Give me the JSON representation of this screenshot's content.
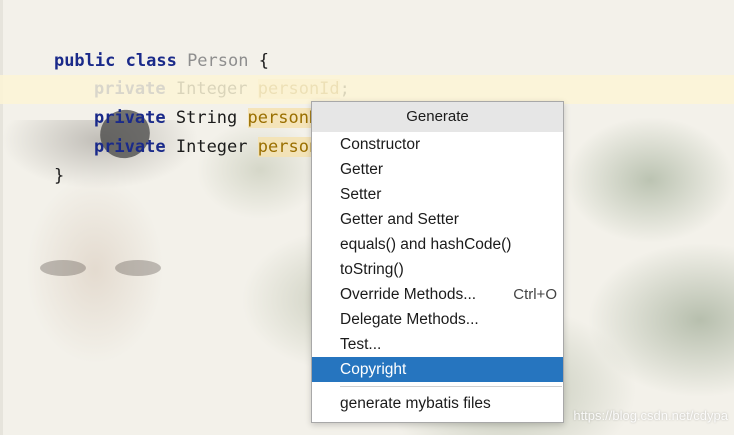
{
  "editor": {
    "lines": [
      {
        "kw1": "public",
        "kw2": "class",
        "class_name": "Person",
        "punct": "{"
      },
      {
        "kw": "private",
        "type": "Integer",
        "field": "personId",
        "punct": ";"
      },
      {
        "kw": "private",
        "type": "String",
        "field": "personName",
        "punct": ";"
      },
      {
        "kw": "private",
        "type": "Integer",
        "field": "personAge",
        "punct": ";"
      },
      {
        "punct": "}"
      }
    ]
  },
  "popup": {
    "title": "Generate",
    "items": [
      {
        "label": "Constructor"
      },
      {
        "label": "Getter"
      },
      {
        "label": "Setter"
      },
      {
        "label": "Getter and Setter"
      },
      {
        "label": "equals() and hashCode()"
      },
      {
        "label": "toString()"
      },
      {
        "label": "Override Methods...",
        "shortcut": "Ctrl+O"
      },
      {
        "label": "Delegate Methods..."
      },
      {
        "label": "Test..."
      },
      {
        "label": "Copyright",
        "selected": true
      }
    ],
    "extra_items": [
      {
        "label": "generate mybatis files"
      }
    ]
  },
  "watermark": "https://blog.csdn.net/cdypa",
  "colors": {
    "keyword": "#1a2a8a",
    "field": "#9a6f00",
    "selection": "#2675bf"
  }
}
